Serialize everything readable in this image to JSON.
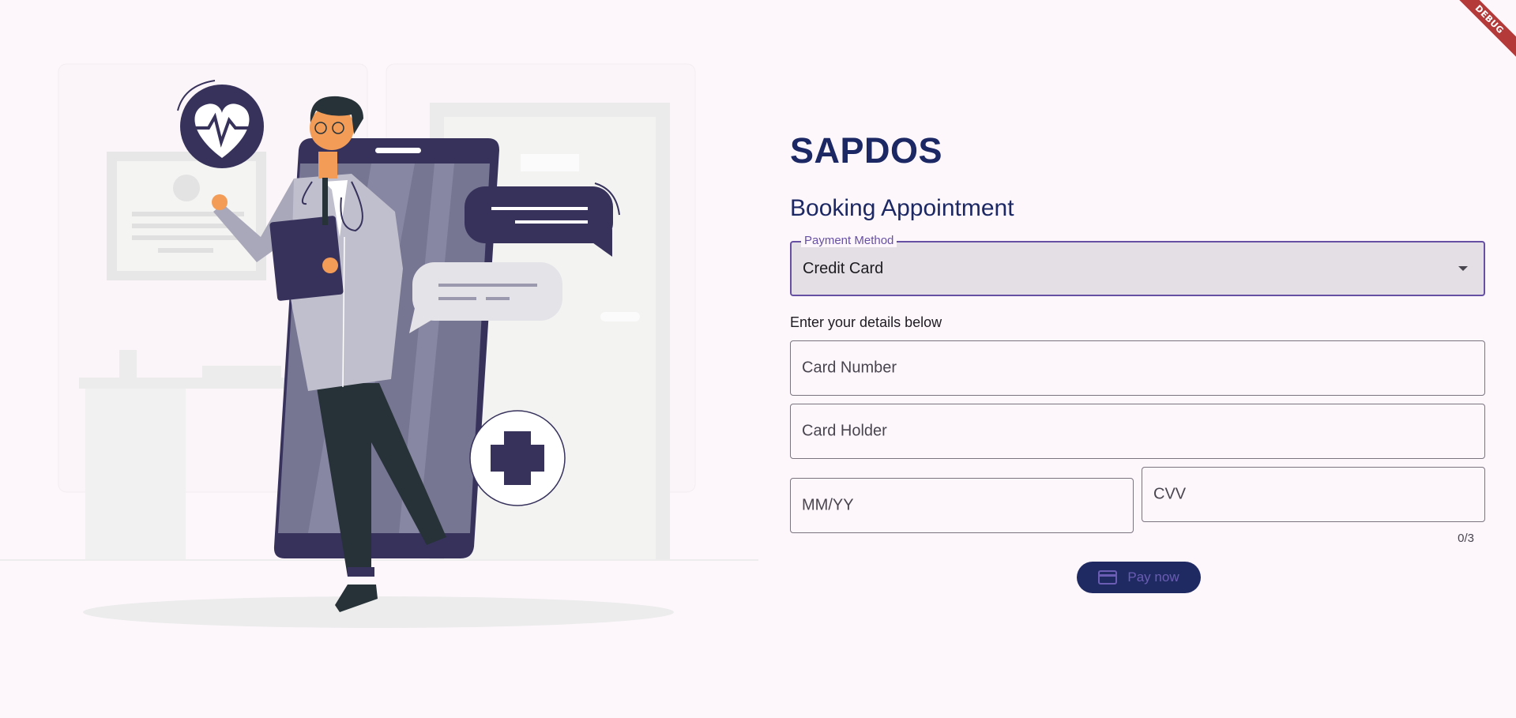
{
  "debug_banner": "DEBUG",
  "app": {
    "brand": "SAPDOS",
    "subtitle": "Booking Appointment"
  },
  "payment": {
    "label": "Payment Method",
    "selected": "Credit Card"
  },
  "form": {
    "instructions": "Enter your details below",
    "card_number_placeholder": "Card Number",
    "card_holder_placeholder": "Card Holder",
    "expiry_placeholder": "MM/YY",
    "cvv_placeholder": "CVV",
    "cvv_counter": "0/3"
  },
  "actions": {
    "pay_label": "Pay now"
  },
  "colors": {
    "brand": "#1c2864",
    "accent": "#6650a4",
    "illustration_dark": "#37325c",
    "button_bg": "#1f2a63"
  },
  "icons": {
    "dropdown": "chevron-down-icon",
    "pay": "credit-card-icon",
    "heart": "heart-pulse-icon",
    "plus": "medical-plus-icon"
  }
}
